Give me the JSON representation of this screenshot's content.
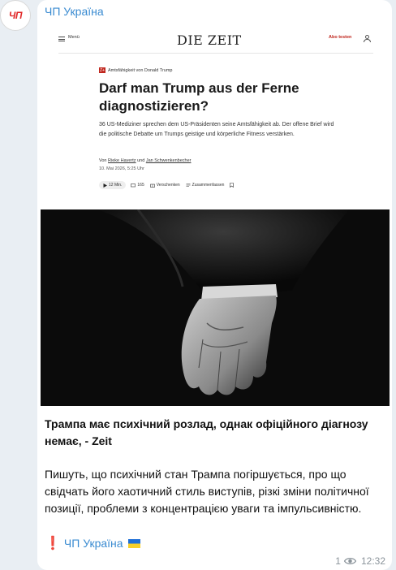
{
  "channel": {
    "avatar_text": "ЧП",
    "name": "ЧП Україна",
    "accent_color": "#3a8bd1"
  },
  "preview": {
    "header": {
      "menu_label": "Menü",
      "logo": "DIE ZEIT",
      "subscribe_label": "Abo testen",
      "user_icon": "user-icon"
    },
    "kicker_badge": "Z+",
    "kicker": "Amtsfähigkeit von Donald Trump",
    "headline": "Darf man Trump aus der Ferne diagnostizieren?",
    "summary": "36 US-Mediziner sprechen dem US-Präsidenten seine Amtsfähigkeit ab. Der offene Brief wird die politische Debatte um Trumps geistige und körperliche Fitness verstärken.",
    "byline_prefix": "Von",
    "author1": "Rieke Havertz",
    "byline_and": "und",
    "author2": "Jan Schwenkenbecher",
    "date": "10. Mai 2026, 5:25 Uhr",
    "actions": {
      "listen": "12 Min.",
      "comments": "165",
      "gift": "Verschenken",
      "summarize": "Zusammenfassen"
    },
    "photo_icon": "image"
  },
  "post": {
    "title": "Трампа має психічний розлад, однак офіційного діагнозу немає, - Zeit",
    "body": "Пишуть, що психічний стан Трампа погіршується, про що свідчать його хаотичний стиль виступів, різкі зміни політичної позиції, проблеми з концентрацією уваги та імпульсивністю.",
    "signature_mark": "❗",
    "signature": "ЧП Україна",
    "flag_icon": "ukraine-flag-icon"
  },
  "meta": {
    "views": "1",
    "time": "12:32"
  }
}
